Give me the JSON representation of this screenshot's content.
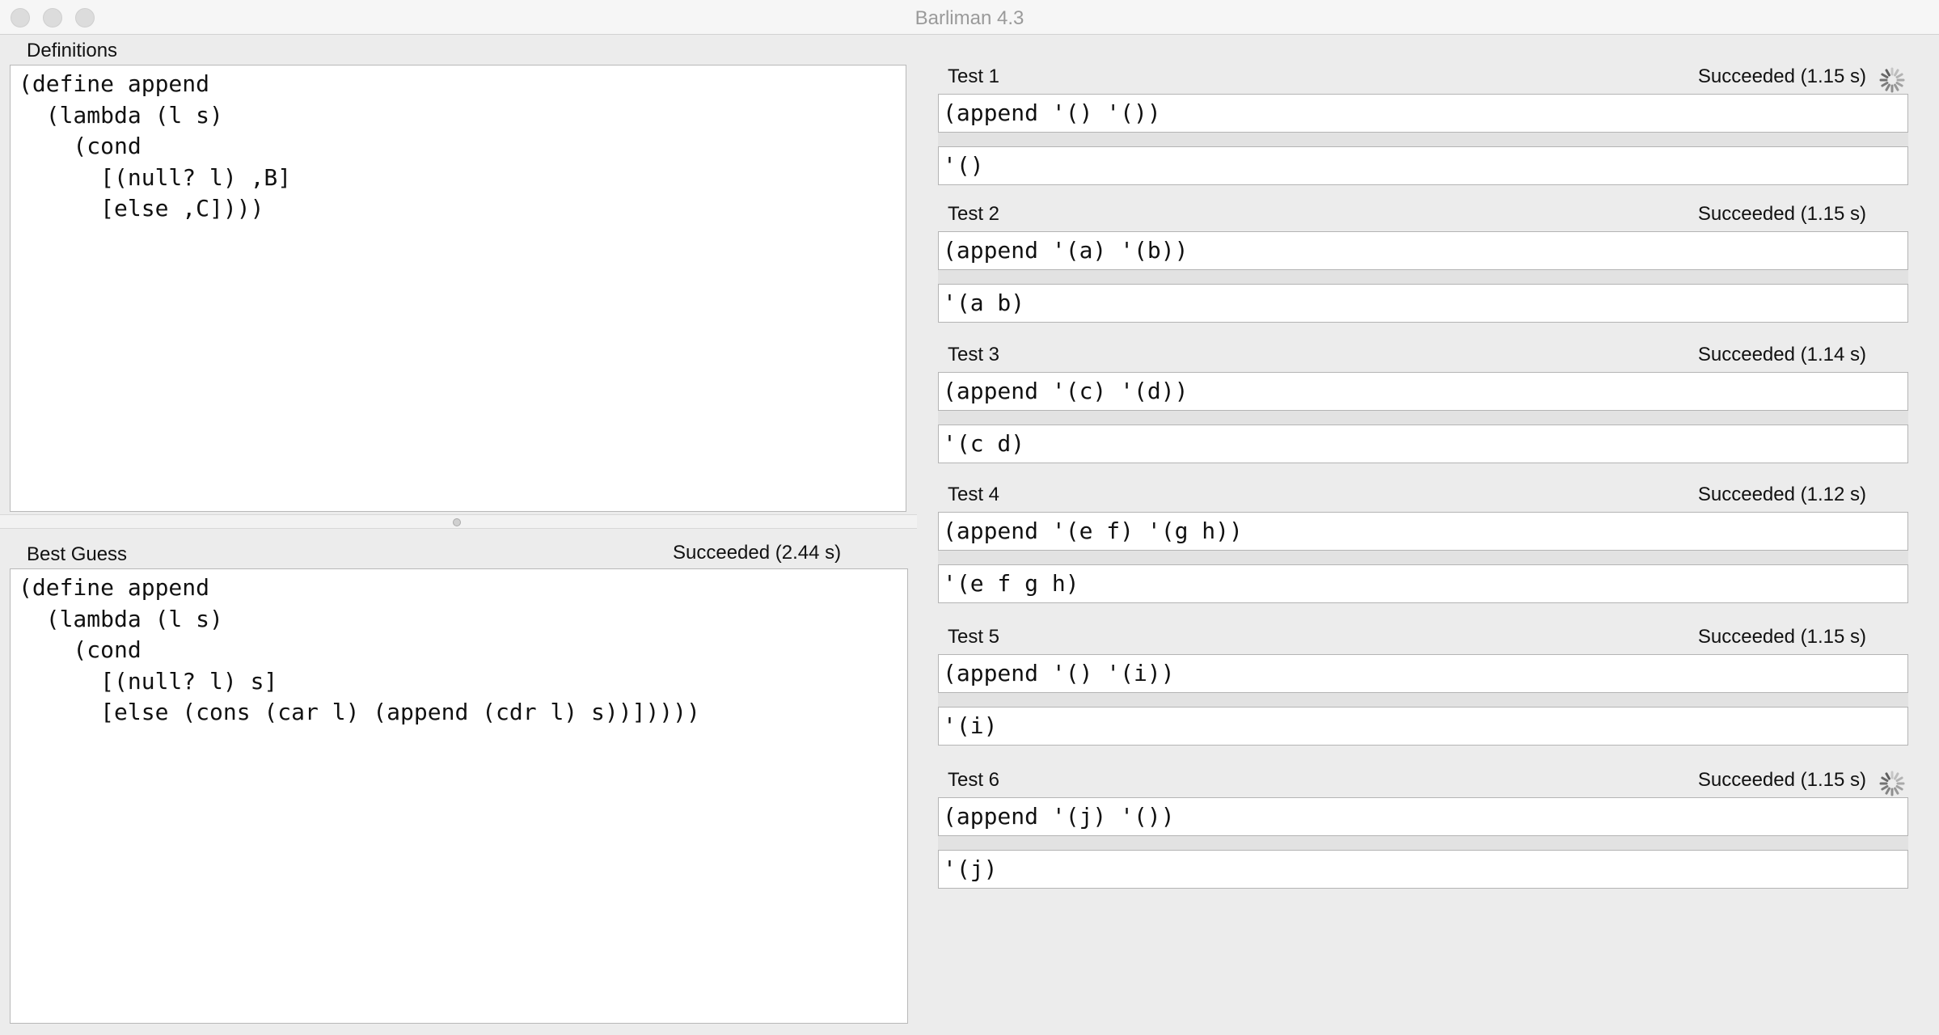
{
  "window": {
    "title": "Barliman 4.3"
  },
  "definitions": {
    "label": "Definitions",
    "code": "(define append\n  (lambda (l s)\n    (cond\n      [(null? l) ,B]\n      [else ,C])))"
  },
  "best_guess": {
    "label": "Best Guess",
    "status": "Succeeded (2.44 s)",
    "code": "(define append\n  (lambda (l s)\n    (cond\n      [(null? l) s]\n      [else (cons (car l) (append (cdr l) s))]))))"
  },
  "tests": [
    {
      "label": "Test 1",
      "status": "Succeeded (1.15 s)",
      "input": "(append '() '())",
      "output": "'()",
      "spinner": true
    },
    {
      "label": "Test 2",
      "status": "Succeeded (1.15 s)",
      "input": "(append '(a) '(b))",
      "output": "'(a b)",
      "spinner": false
    },
    {
      "label": "Test 3",
      "status": "Succeeded (1.14 s)",
      "input": "(append '(c) '(d))",
      "output": "'(c d)",
      "spinner": false
    },
    {
      "label": "Test 4",
      "status": "Succeeded (1.12 s)",
      "input": "(append '(e f) '(g h))",
      "output": "'(e f g h)",
      "spinner": false
    },
    {
      "label": "Test 5",
      "status": "Succeeded (1.15 s)",
      "input": "(append '() '(i))",
      "output": "'(i)",
      "spinner": false
    },
    {
      "label": "Test 6",
      "status": "Succeeded (1.15 s)",
      "input": "(append '(j) '())",
      "output": "'(j)",
      "spinner": true
    }
  ]
}
